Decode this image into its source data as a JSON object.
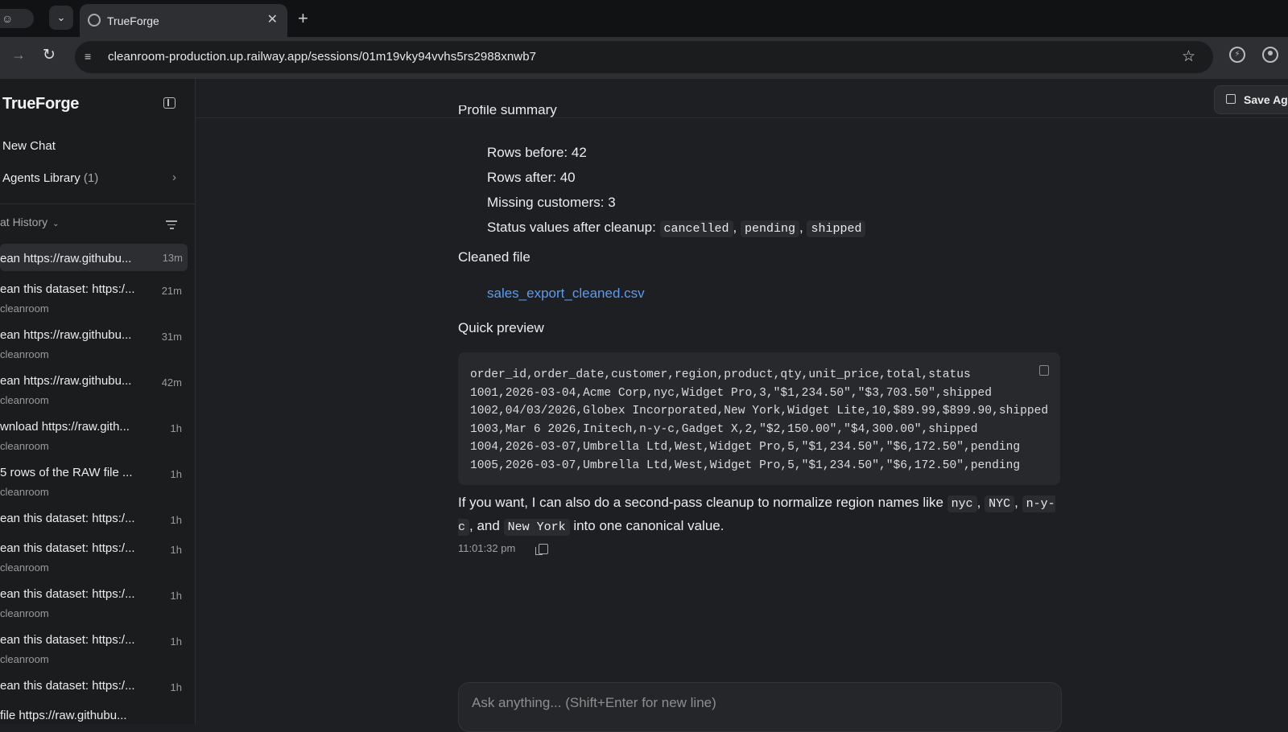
{
  "browser": {
    "tab_title": "TrueForge",
    "url": "cleanroom-production.up.railway.app/sessions/01m19vky94vvhs5rs2988xnwb7"
  },
  "sidebar": {
    "brand": "TrueForge",
    "new_chat": "New Chat",
    "agents_library": "Agents Library",
    "agents_count": "(1)",
    "history_label": "at History",
    "history": [
      {
        "title": "ean https://raw.githubu...",
        "sub": "",
        "time": "13m"
      },
      {
        "title": "ean this dataset: https:/...",
        "sub": "cleanroom",
        "time": "21m"
      },
      {
        "title": "ean https://raw.githubu...",
        "sub": "cleanroom",
        "time": "31m"
      },
      {
        "title": "ean https://raw.githubu...",
        "sub": "cleanroom",
        "time": "42m"
      },
      {
        "title": "wnload https://raw.gith...",
        "sub": "cleanroom",
        "time": "1h"
      },
      {
        "title": "5 rows of the RAW file ...",
        "sub": "cleanroom",
        "time": "1h"
      },
      {
        "title": "ean this dataset: https:/...",
        "sub": "",
        "time": "1h"
      },
      {
        "title": "ean this dataset: https:/...",
        "sub": "cleanroom",
        "time": "1h"
      },
      {
        "title": "ean this dataset: https:/...",
        "sub": "cleanroom",
        "time": "1h"
      },
      {
        "title": "ean this dataset: https:/...",
        "sub": "cleanroom",
        "time": "1h"
      },
      {
        "title": "ean this dataset: https:/...",
        "sub": "",
        "time": "1h"
      },
      {
        "title": "file https://raw.githubu...",
        "sub": "",
        "time": ""
      }
    ]
  },
  "header": {
    "save_label": "Save Ag"
  },
  "message": {
    "profile_heading": "Profile summary",
    "rows_before": "Rows before: 42",
    "rows_after": "Rows after: 40",
    "missing_customers": "Missing customers: 3",
    "status_prefix": "Status values after cleanup:",
    "status_values": [
      "cancelled",
      "pending",
      "shipped"
    ],
    "cleaned_heading": "Cleaned file",
    "cleaned_file": "sales_export_cleaned.csv",
    "preview_heading": "Quick preview",
    "preview_code": "order_id,order_date,customer,region,product,qty,unit_price,total,status\n1001,2026-03-04,Acme Corp,nyc,Widget Pro,3,\"$1,234.50\",\"$3,703.50\",shipped\n1002,04/03/2026,Globex Incorporated,New York,Widget Lite,10,$89.99,$899.90,shipped\n1003,Mar 6 2026,Initech,n-y-c,Gadget X,2,\"$2,150.00\",\"$4,300.00\",shipped\n1004,2026-03-07,Umbrella Ltd,West,Widget Pro,5,\"$1,234.50\",\"$6,172.50\",pending\n1005,2026-03-07,Umbrella Ltd,West,Widget Pro,5,\"$1,234.50\",\"$6,172.50\",pending",
    "followup_1": "If you want, I can also do a second-pass cleanup to normalize region names like",
    "region_1": "nyc",
    "region_2": "NYC",
    "region_3": "n-y-c",
    "and": ", and",
    "region_4": "New York",
    "followup_2": "into one canonical value.",
    "timestamp": "11:01:32 pm"
  },
  "composer": {
    "placeholder": "Ask anything... (Shift+Enter for new line)"
  },
  "colors": {
    "link": "#5b9bf0",
    "background": "#1e1f22",
    "sidebar": "#1b1c1e"
  }
}
